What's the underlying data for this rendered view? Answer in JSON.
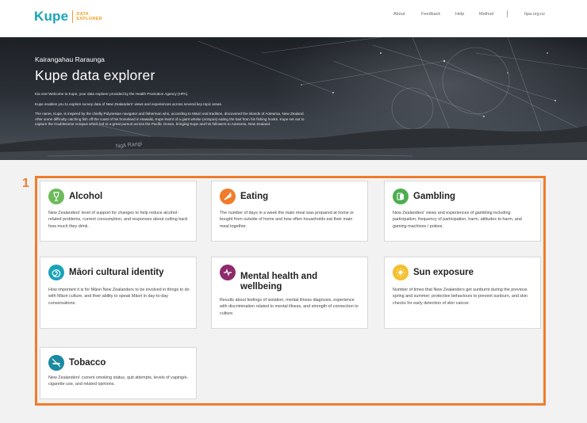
{
  "header": {
    "logo_word": "Kupe",
    "logo_sub_line1": "DATA",
    "logo_sub_line2": "EXPLORER",
    "nav": [
      "About",
      "Feedback",
      "Help",
      "Method",
      "hpa.org.nz"
    ]
  },
  "hero": {
    "eyebrow": "Kairangahau Raraunga",
    "title": "Kupe data explorer",
    "p1": "Kia ora! Welcome to Kupe, your data explorer provided by the Health Promotion Agency (HPA).",
    "p2": "Kupe enables you to explore survey data of New Zealanders' views and experiences across several key topic areas.",
    "p3": "The name, Kupe, is inspired by the chiefly Polynesian navigator and fisherman who, according to Māori oral tradition, discovered the islands of Aotearoa, New Zealand. After some difficulty catching fish off the coast of his homeland in Hawaiki, Kupe learnt of a giant wheke (octopus) eating the bait from his fishing hooks. Kupe set out to capture the troublesome octopus which led to a great pursuit across the Pacific Ocean, bringing Kupe and his followers to Aotearoa, New Zealand.",
    "constellation_label": "Ngā Rangi"
  },
  "step_number": "1",
  "topics": [
    {
      "name": "Alcohol",
      "icon": "glass-icon",
      "color": "#6cbb5a",
      "desc": "New Zealanders' level of support for changes to help reduce alcohol-related problems, current consumption, and responses about cutting back how much they drink."
    },
    {
      "name": "Eating",
      "icon": "carrot-icon",
      "color": "#f07c2a",
      "desc": "The number of days in a week the main meal was prepared at home or bought from outside of home and how often households eat their main meal together."
    },
    {
      "name": "Gambling",
      "icon": "cards-icon",
      "color": "#4caf50",
      "desc": "New Zealanders' views and experiences of gambling including participation, frequency of participation, harm, attitudes to harm, and gaming machines / pokies."
    },
    {
      "name": "Māori cultural identity",
      "icon": "koru-icon",
      "color": "#1aa3b8",
      "desc": "How important it is for Māori New Zealanders to be involved in things to do with Māori culture, and their ability to speak Māori in day-to-day conversations."
    },
    {
      "name": "Mental health and wellbeing",
      "icon": "heartbeat-icon",
      "color": "#8e2a6b",
      "desc": "Results about feelings of isolation, mental illness diagnosis, experience with discrimination related to mental illness, and strength of connection to culture."
    },
    {
      "name": "Sun exposure",
      "icon": "sun-icon",
      "color": "#f5c02c",
      "desc": "Number of times that New Zealanders get sunburnt during the previous spring and summer; protective behaviours to prevent sunburn, and skin checks for early detection of skin cancer."
    },
    {
      "name": "Tobacco",
      "icon": "no-smoking-icon",
      "color": "#1a8aa0",
      "desc": "New Zealanders' current smoking status, quit attempts, levels of vaping/e-cigarette use, and related opinions."
    }
  ]
}
